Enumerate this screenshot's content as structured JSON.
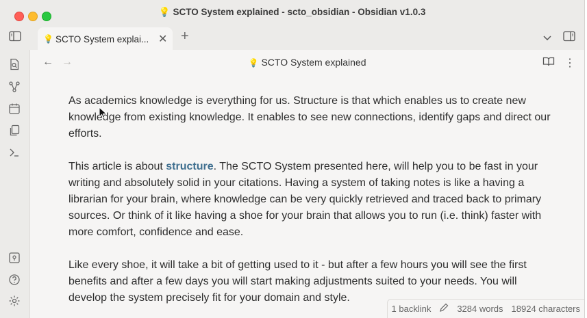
{
  "window": {
    "title": "SCTO System explained - scto_obsidian - Obsidian v1.0.3",
    "title_icon": "lightbulb-icon"
  },
  "tab": {
    "label": "SCTO System explai...",
    "icon": "lightbulb-icon"
  },
  "view": {
    "title": "SCTO System explained"
  },
  "doc": {
    "p1": "As academics knowledge is everything for us. Structure is that which enables us to create new knowledge from existing knowledge. It enables to see new connections, identify gaps and direct our efforts.",
    "p2_before": "This article is about ",
    "p2_link": "structure",
    "p2_after": ". The SCTO System presented here, will help you to be fast in your writing and absolutely solid in your citations. Having a system of taking notes is like a having a librarian for your brain, where knowledge can be very quickly retrieved and traced back to primary sources. Or think of it like having a shoe for your brain that allows you to run (i.e. think) faster with more comfort, confidence and ease.",
    "p3": "Like every shoe, it will take a bit of getting used to it - but after a few hours you will see the first benefits and after a few days you will start making adjustments suited to your needs. You will develop the system precisely fit for your domain and style."
  },
  "status": {
    "backlinks": "1 backlink",
    "words": "3284 words",
    "characters": "18924 characters"
  },
  "colors": {
    "accent": "#3f6f8f",
    "background": "#f6f5f4",
    "chrome": "#ecebe9"
  }
}
